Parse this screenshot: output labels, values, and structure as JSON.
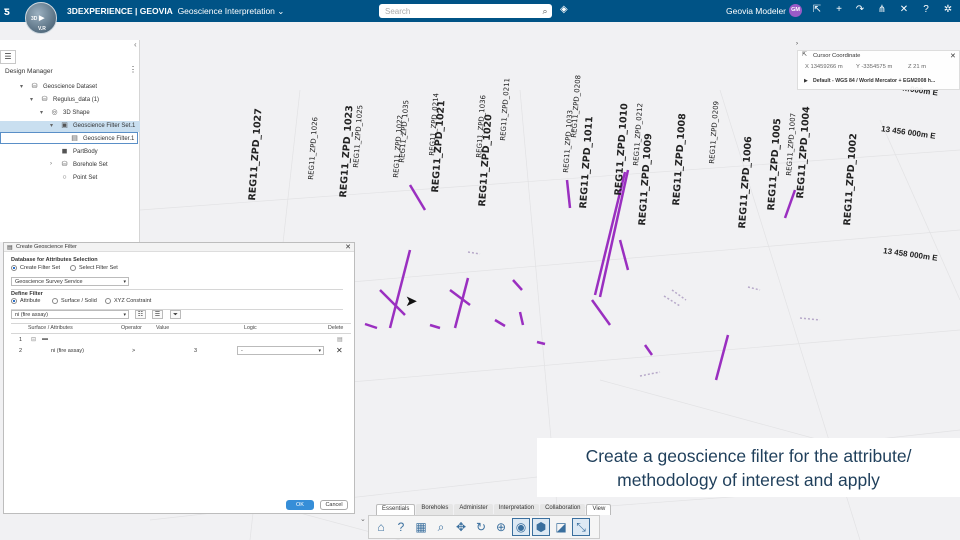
{
  "topbar": {
    "brand_bold": "3DEXPERIENCE | GEOVIA",
    "app_name": "Geoscience Interpretation",
    "search_placeholder": "Search",
    "user": "Geovia Modeler",
    "avatar": "GM",
    "compass_labels": [
      "3D",
      "V.R"
    ],
    "icons": [
      "chevron-down-icon",
      "search-icon",
      "tag-icon",
      "share-icon",
      "plus-icon",
      "forward-icon",
      "network-icon",
      "tools-icon",
      "help-icon",
      "collaboration-icon"
    ]
  },
  "panel": {
    "title": "Design Manager",
    "tree": [
      {
        "label": "Geoscience Dataset"
      },
      {
        "label": "Regulus_data (1)"
      },
      {
        "label": "3D Shape"
      },
      {
        "label": "Geoscience Filter Set.1"
      },
      {
        "label": "Geoscience Filter.1"
      },
      {
        "label": "PartBody"
      },
      {
        "label": "Borehole Set"
      },
      {
        "label": "Point Set"
      }
    ]
  },
  "dialog": {
    "title": "Create Geoscience Filter",
    "db_section": "Database for Attributes Selection",
    "radio_create": "Create Filter Set",
    "radio_select": "Select Filter Set",
    "service": "Geoscience Survey Service",
    "define_section": "Define Filter",
    "radio_attribute": "Attribute",
    "radio_surface": "Surface / Solid",
    "radio_xyz": "XYZ Constraint",
    "attribute_combo": "ni (fire assay)",
    "columns": [
      "Surface / Attributes",
      "Operator",
      "Value",
      "Logic",
      "Delete"
    ],
    "rows": [
      {
        "idx": "1",
        "attr": "",
        "op": "",
        "value": "",
        "logic": ""
      },
      {
        "idx": "2",
        "attr": "ni (fire assay)",
        "op": ">",
        "value": "3",
        "logic": "-"
      }
    ],
    "ok": "OK",
    "cancel": "Cancel"
  },
  "cursor": {
    "title": "Cursor Coordinate",
    "x": "X 13459266 m",
    "y": "Y -3354575 m",
    "z": "Z 21 m",
    "crs": "Default - WGS 84 / World Mercator + EGM2008 h..."
  },
  "viewport": {
    "well_labels": [
      "REG11_ZPD_1027",
      "REG11_ZPD_1026",
      "REG11_ZPD_1023",
      "REG11_ZPD_1025",
      "REG11_ZPD_1022",
      "REG11_ZPD_1035",
      "REG11_ZPD_0214",
      "REG11_ZPD_1021",
      "REG11_ZPD_1036",
      "REG11_ZPD_1020",
      "REG11_ZPD_0211",
      "REG11_ZPD_1033",
      "REG11_ZPD_0208",
      "REG11_ZPD_1011",
      "REG11_ZPD_1010",
      "REG11_ZPD_0212",
      "REG11_ZPD_1009",
      "REG11_ZPD_1008",
      "REG11_ZPD_0209",
      "REG11_ZPD_1006",
      "REG11_ZPD_1005",
      "REG11_ZPD_1007",
      "REG11_ZPD_1004",
      "REG11_ZPD_1002"
    ],
    "coords": [
      "13 456 000m E",
      "13 458 000m E",
      "…000m E"
    ]
  },
  "caption": {
    "line1": "Create a geoscience filter for the attribute/",
    "line2": "methodology of interest and apply"
  },
  "toolbar": {
    "tabs": [
      "Essentials",
      "Boreholes",
      "Administer",
      "Interpretation",
      "Collaboration",
      "View"
    ],
    "active_tab": "View",
    "icons": [
      "home-icon",
      "help-icon",
      "layer-icon",
      "zoom-icon",
      "pan-icon",
      "rotate-icon",
      "zoom-area-icon",
      "render-icon",
      "cube-icon",
      "compass-icon",
      "measure-icon"
    ]
  },
  "colors": {
    "topbar": "#005386",
    "accent": "#9a2fc0",
    "ok": "#368ed8"
  }
}
